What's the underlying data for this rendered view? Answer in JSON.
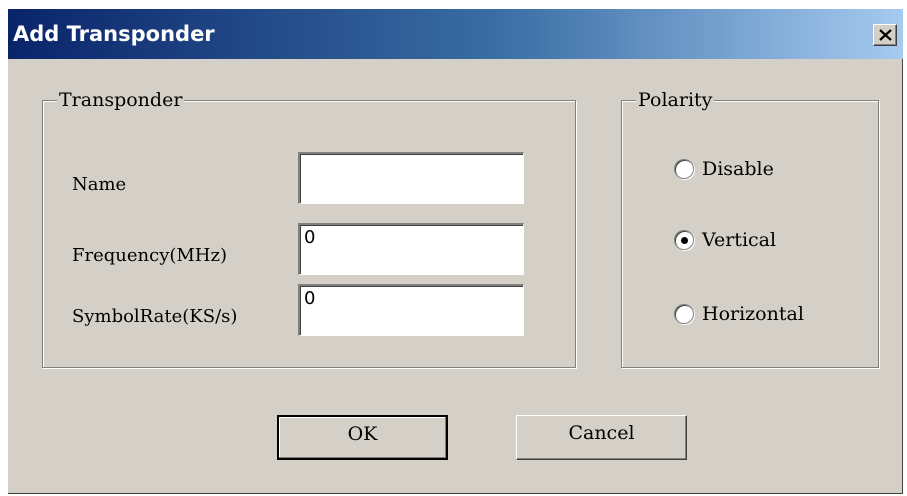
{
  "window": {
    "title": "Add Transponder",
    "close_icon": "close-icon"
  },
  "transponder_group": {
    "legend": "Transponder",
    "fields": [
      {
        "label": "Name",
        "value": ""
      },
      {
        "label": "Frequency(MHz)",
        "value": "0"
      },
      {
        "label": "SymbolRate(KS/s)",
        "value": "0"
      }
    ]
  },
  "polarity_group": {
    "legend": "Polarity",
    "options": [
      {
        "label": "Disable",
        "selected": false
      },
      {
        "label": "Vertical",
        "selected": true
      },
      {
        "label": "Horizontal",
        "selected": false
      }
    ]
  },
  "buttons": {
    "ok": "OK",
    "cancel": "Cancel"
  },
  "colors": {
    "titlebar_start": "#0a246a",
    "titlebar_end": "#a6caf0",
    "dialog_face": "#d4d0c8"
  }
}
